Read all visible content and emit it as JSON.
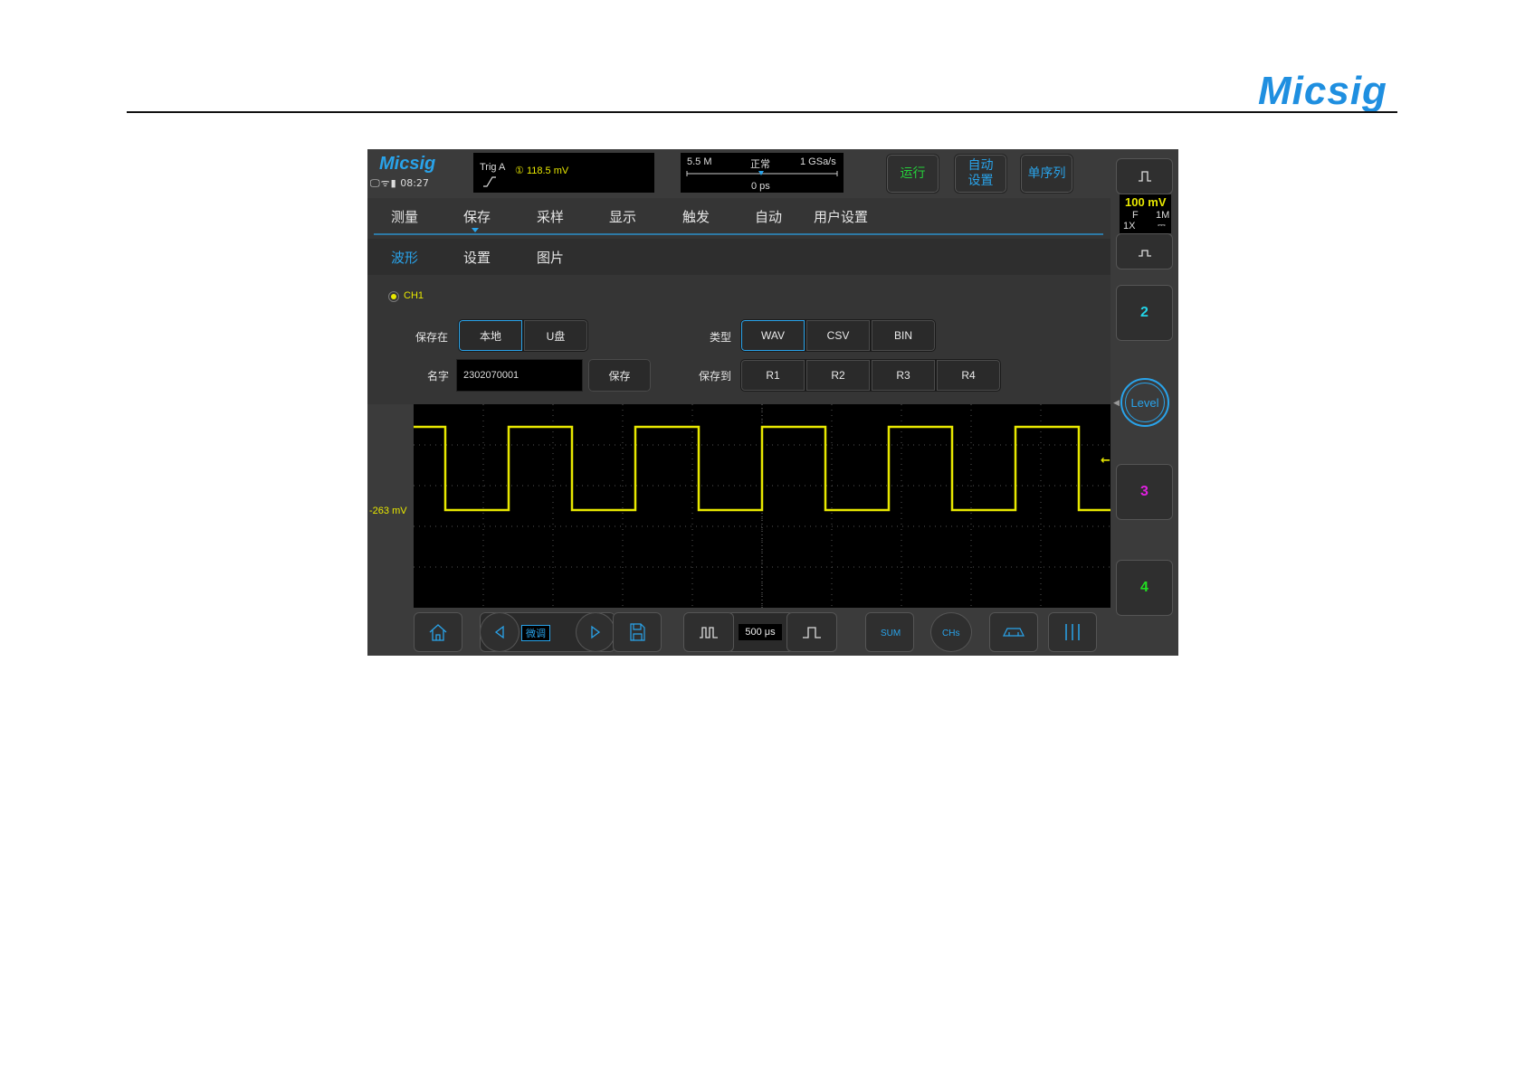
{
  "page": {
    "brand": "Micsig"
  },
  "status_bar": {
    "logo": "Micsig",
    "time": "08:27",
    "trigger": {
      "label": "Trig  A",
      "channel_marker": "①",
      "level": "118.5  mV"
    },
    "acquisition": {
      "memory": "5.5 M",
      "mode": "正常",
      "sample_rate": "1 GSa/s",
      "trigger_position": "0 ps"
    },
    "buttons": {
      "run": "运行",
      "auto_setup": "自动\n设置",
      "single_seq": "单序列"
    }
  },
  "menu": {
    "tabs": [
      "测量",
      "保存",
      "采样",
      "显示",
      "触发",
      "自动",
      "用户设置"
    ],
    "active_tab": "保存",
    "subtabs": [
      "波形",
      "设置",
      "图片"
    ],
    "active_subtab": "波形"
  },
  "save_waveform": {
    "channel": "CH1",
    "save_location_label": "保存在",
    "save_location_options": [
      "本地",
      "U盘"
    ],
    "save_location_selected": "本地",
    "name_label": "名字",
    "name_value": "2302070001",
    "save_button": "保存",
    "type_label": "类型",
    "type_options": [
      "WAV",
      "CSV",
      "BIN"
    ],
    "type_selected": "WAV",
    "save_to_label": "保存到",
    "save_to_options": [
      "R1",
      "R2",
      "R3",
      "R4"
    ]
  },
  "waveform": {
    "offset_label": "-263 mV",
    "channel_marker": "1",
    "trigger_marker": "←"
  },
  "right_panel": {
    "ch1": {
      "scale": "100 mV",
      "bandwidth": "F",
      "impedance": "1M",
      "probe": "1X",
      "coupling": "⎓"
    },
    "level_button": "Level",
    "channels": [
      "2",
      "3",
      "4"
    ],
    "channel_colors": {
      "ch1": "#e8e800",
      "ch2": "#22d3e6",
      "ch3": "#e020e0",
      "ch4": "#22dd22"
    }
  },
  "bottom_toolbar": {
    "fine_label": "微调",
    "timebase": "500 μs",
    "icons": [
      "home-icon",
      "prev-icon",
      "next-icon",
      "save-file-icon",
      "timebase-dec-icon",
      "timebase-inc-icon",
      "sum-icon",
      "channels-icon",
      "cursor-icon",
      "menu-bars-icon"
    ]
  }
}
